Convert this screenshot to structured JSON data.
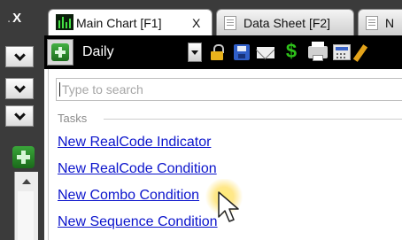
{
  "left_panel": {
    "close_label": "X"
  },
  "tabs": [
    {
      "label": "Main Chart  [F1]",
      "close": "X",
      "icon": "chart-icon",
      "active": true
    },
    {
      "label": "Data Sheet  [F2]",
      "icon": "sheet-icon",
      "active": false
    },
    {
      "label": "N",
      "icon": "sheet-icon",
      "active": false
    }
  ],
  "toolbar": {
    "period_value": "Daily",
    "icons": [
      "add-icon",
      "lock-icon",
      "save-icon",
      "mail-icon",
      "dollar-icon",
      "printer-icon",
      "calculator-icon",
      "pencil-icon"
    ],
    "dollar_glyph": "$"
  },
  "menu": {
    "search_placeholder": "Type to search",
    "search_value": "",
    "section_title": "Tasks",
    "items": [
      {
        "label": "New RealCode Indicator"
      },
      {
        "label": "New RealCode Condition"
      },
      {
        "label": "New Combo Condition"
      },
      {
        "label": "New Sequence Condition"
      }
    ]
  },
  "colors": {
    "toolbar_bg": "#000000",
    "panel_bg": "#3b3b3b",
    "link": "#0b14cc",
    "highlight": "#ffe86a"
  }
}
